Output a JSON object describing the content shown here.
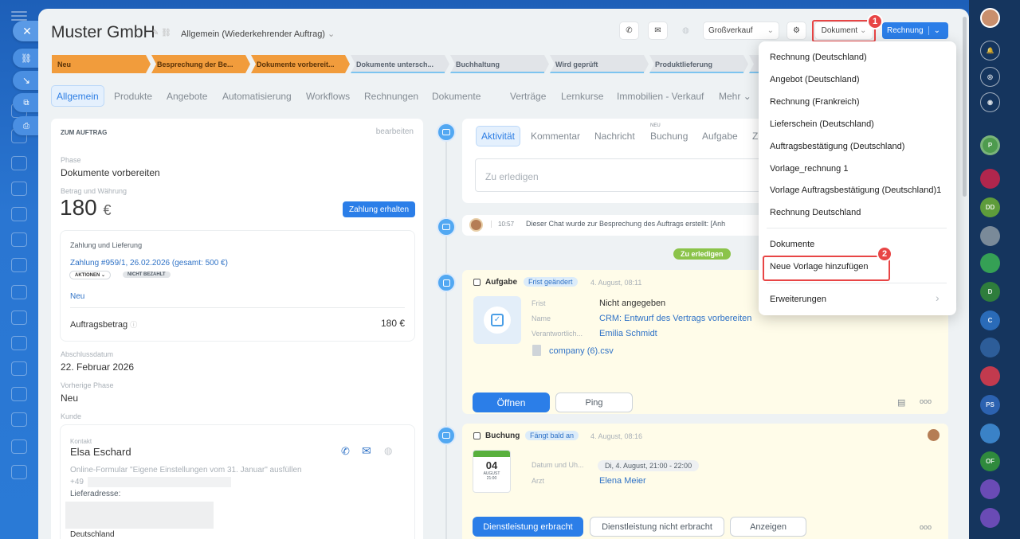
{
  "header": {
    "title": "Muster GmbH",
    "deal_type": "Allgemein (Wiederkehrender Auftrag)",
    "grossverkauf": "Großverkauf",
    "document_btn": "Dokument",
    "invoice_btn": "Rechnung"
  },
  "badges": {
    "b1": "1",
    "b2": "2"
  },
  "stages": [
    "Neu",
    "Besprechung der Be...",
    "Dokumente vorbereit...",
    "Dokumente untersch...",
    "Buchhaltung",
    "Wird geprüft",
    "Produktlieferung"
  ],
  "tabs": [
    "Allgemein",
    "Produkte",
    "Angebote",
    "Automatisierung",
    "Workflows",
    "Rechnungen",
    "Dokumente",
    "Verträge",
    "Lernkurse",
    "Immobilien - Verkauf",
    "Mehr"
  ],
  "left": {
    "section_title": "ZUM AUFTRAG",
    "edit": "bearbeiten",
    "phase_label": "Phase",
    "phase_value": "Dokumente vorbereiten",
    "amount_label": "Betrag und Währung",
    "amount": "180",
    "currency": "€",
    "payment_btn": "Zahlung erhalten",
    "payment_title": "Zahlung und Lieferung",
    "payment_link": "Zahlung #959/1, 26.02.2026 (gesamt: 500 €)",
    "actions": "AKTIONEN",
    "not_paid": "NICHT BEZAHLT",
    "new_link": "Neu",
    "order_amount_label": "Auftragsbetrag",
    "order_amount": "180 €",
    "close_date_label": "Abschlussdatum",
    "close_date": "22. Februar 2026",
    "prev_phase_label": "Vorherige Phase",
    "prev_phase": "Neu",
    "customer_label": "Kunde",
    "contact_label": "Kontakt",
    "contact_name": "Elsa Eschard",
    "form_text": "Online-Formular \"Eigene Einstellungen vom 31. Januar\" ausfüllen",
    "phone": "+49",
    "delivery_label": "Lieferadresse:",
    "country": "Deutschland"
  },
  "feed": {
    "tabs": [
      "Aktivität",
      "Kommentar",
      "Nachricht",
      "Buchung",
      "Aufgabe",
      "Z"
    ],
    "new_tag": "NEU",
    "placeholder": "Zu erledigen",
    "chat_time": "10:57",
    "chat_text": "Dieser Chat wurde zur Besprechung des Auftrags erstellt: [Anh",
    "todo_divider": "Zu erledigen"
  },
  "task": {
    "title": "Aufgabe",
    "tag": "Frist geändert",
    "date": "4. August, 08:11",
    "frist_label": "Frist",
    "frist_value": "Nicht angegeben",
    "name_label": "Name",
    "name_value": "CRM: Entwurf des Vertrags vorbereiten",
    "resp_label": "Verantwortlich...",
    "resp_value": "Emilia Schmidt",
    "file": "company (6).csv",
    "open_btn": "Öffnen",
    "ping_btn": "Ping",
    "more": "ooo"
  },
  "booking": {
    "title": "Buchung",
    "tag": "Fängt bald an",
    "date": "4. August, 08:16",
    "date_label": "Datum und Uh...",
    "date_value": "Di, 4. August, 21:00 - 22:00",
    "doctor_label": "Arzt",
    "doctor_value": "Elena Meier",
    "cal_day": "04",
    "cal_month": "AUGUST",
    "cal_time": "21:00",
    "done_btn": "Dienstleistung erbracht",
    "notdone_btn": "Dienstleistung nicht erbracht",
    "show_btn": "Anzeigen",
    "more": "ooo"
  },
  "menu": {
    "items": [
      "Rechnung (Deutschland)",
      "Angebot (Deutschland)",
      "Rechnung (Frankreich)",
      "Lieferschein (Deutschland)",
      "Auftragsbestätigung (Deutschland)",
      "Vorlage_rechnung 1",
      "Vorlage Auftragsbestätigung (Deutschland)1",
      "Rechnung Deutschland"
    ],
    "documents": "Dokumente",
    "add_template": "Neue Vorlage hinzufügen",
    "extensions": "Erweiterungen"
  },
  "rightbar": {
    "p": "P",
    "dd": "DD",
    "d": "D",
    "c": "C",
    "of": "OF",
    "ps": "PS"
  }
}
